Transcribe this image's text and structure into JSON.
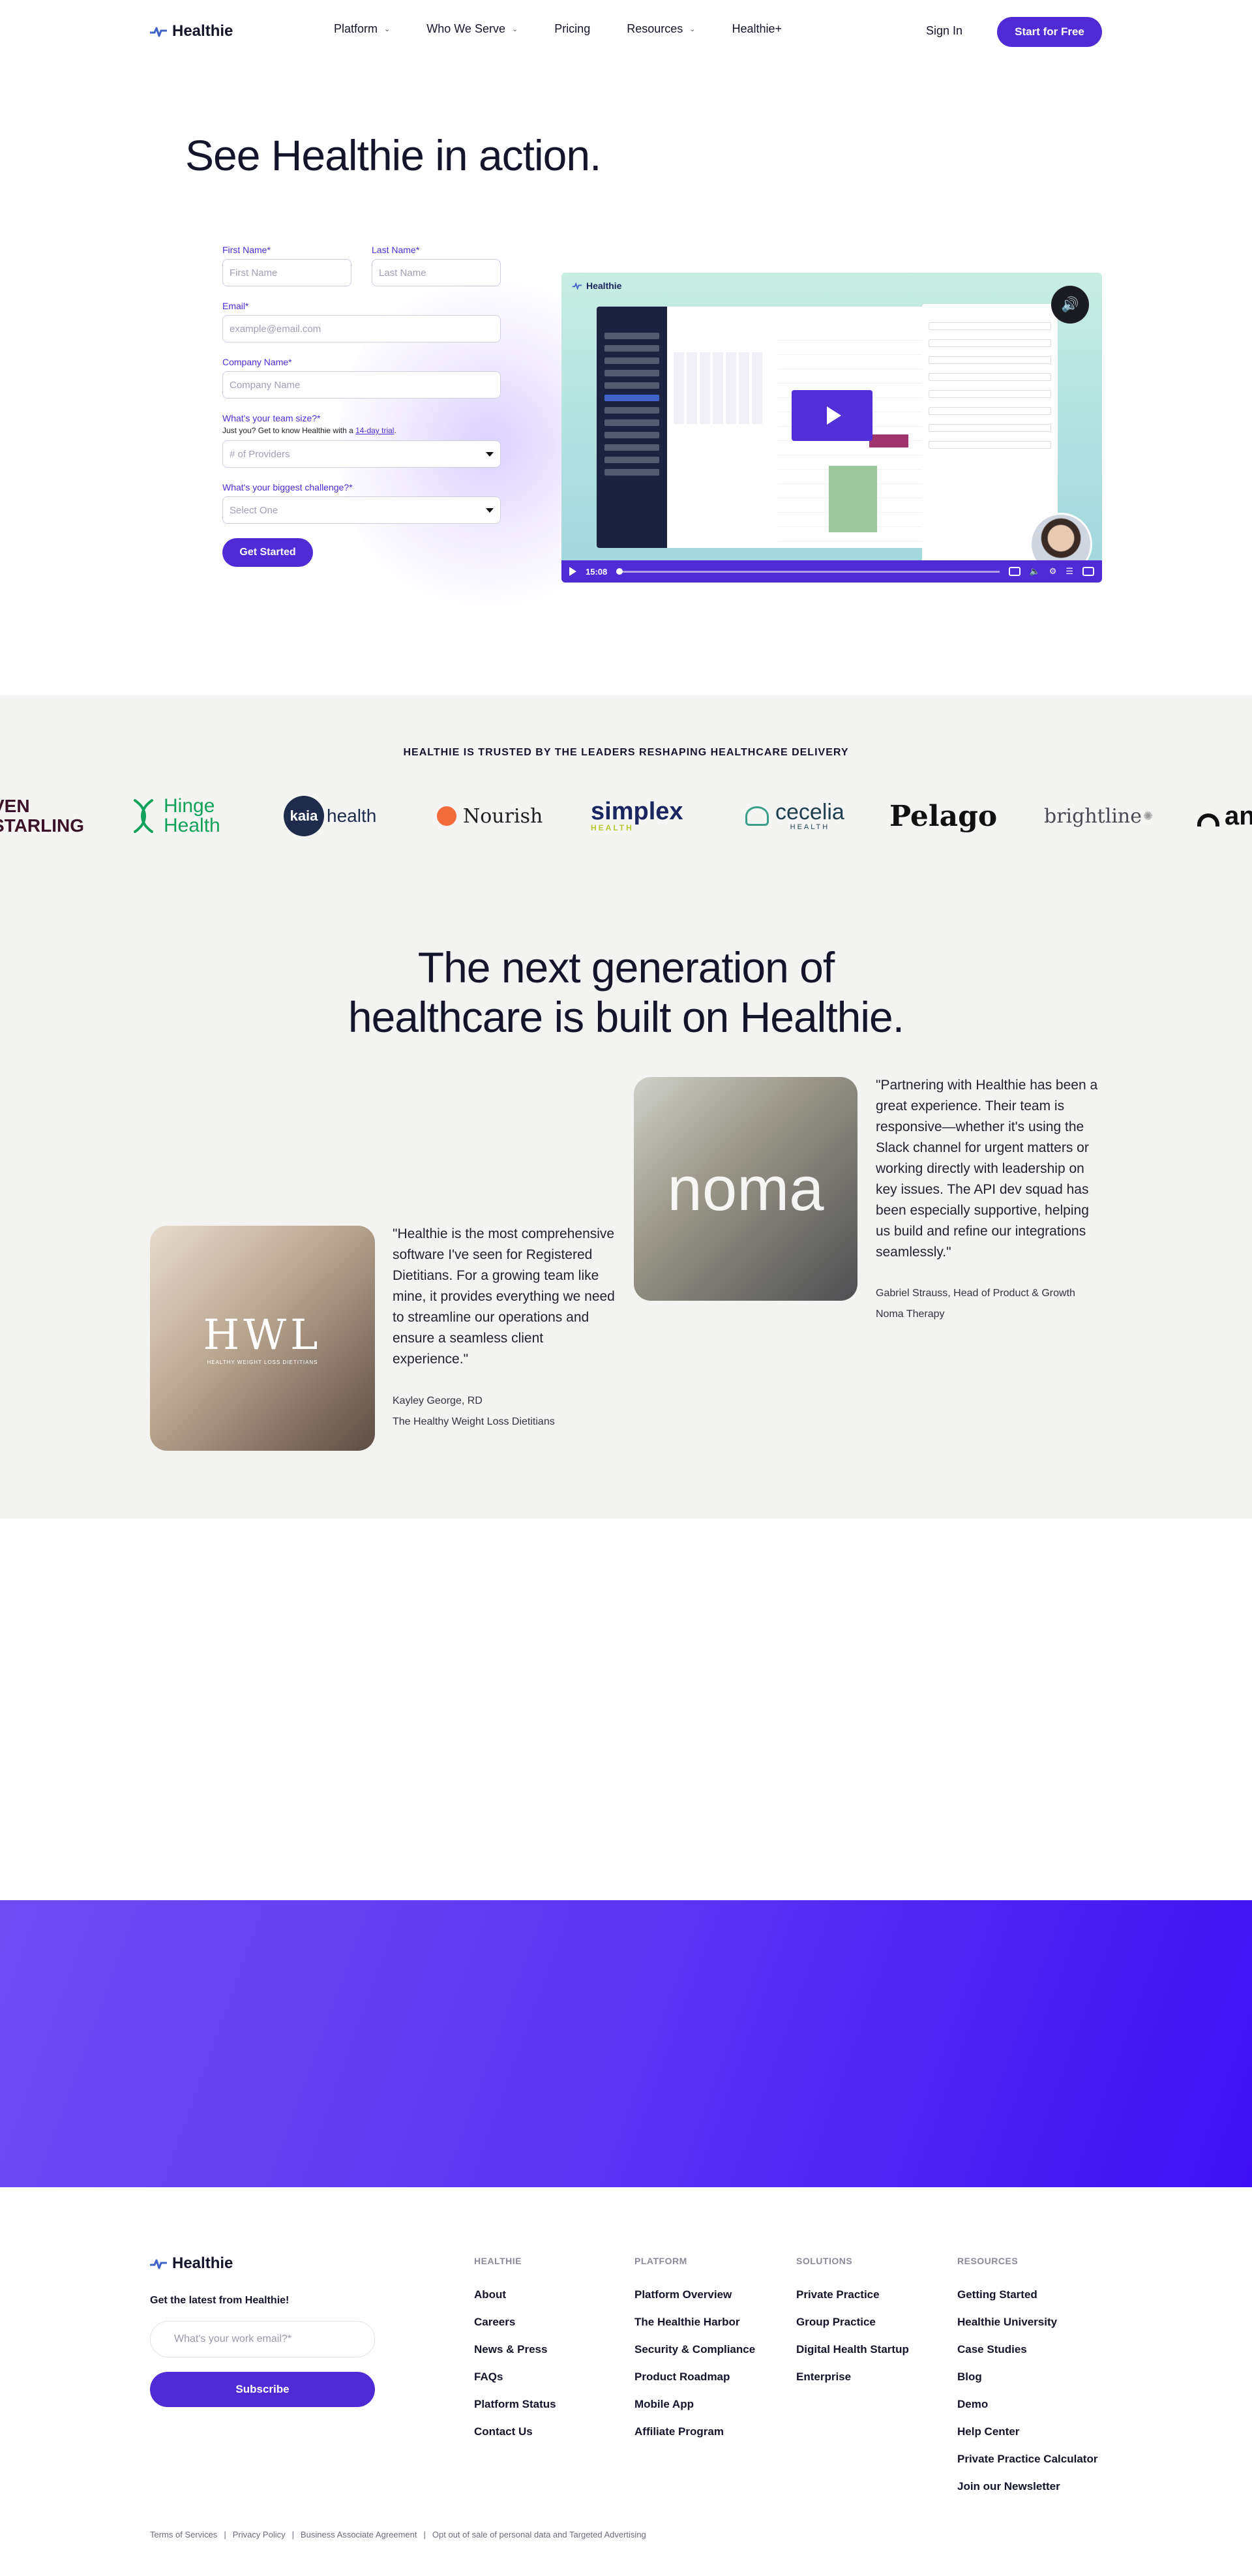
{
  "nav": {
    "brand": "Healthie",
    "links": [
      {
        "label": "Platform",
        "has_menu": true
      },
      {
        "label": "Who We Serve",
        "has_menu": true
      },
      {
        "label": "Pricing",
        "has_menu": false
      },
      {
        "label": "Resources",
        "has_menu": true
      },
      {
        "label": "Healthie+",
        "has_menu": false
      }
    ],
    "signin": "Sign In",
    "cta": "Start for Free"
  },
  "hero": {
    "title": "See Healthie in action."
  },
  "form": {
    "first_name_label": "First Name*",
    "first_name_placeholder": "First Name",
    "last_name_label": "Last Name*",
    "last_name_placeholder": "Last Name",
    "email_label": "Email*",
    "email_placeholder": "example@email.com",
    "company_label": "Company Name*",
    "company_placeholder": "Company Name",
    "team_size_label": "What's your team size?*",
    "team_size_hint": "Just you? Get to know Healthie with a ",
    "team_size_hint_link": "14-day trial",
    "team_size_hint_end": ".",
    "team_size_value": "# of Providers",
    "challenge_label": "What's your biggest challenge?*",
    "challenge_value": "Select One",
    "submit": "Get Started"
  },
  "video": {
    "brand": "Healthie",
    "time": "15:08",
    "sound_icon": "speaker-icon"
  },
  "trusted": {
    "title": "HEALTHIE IS TRUSTED BY THE LEADERS RESHAPING HEALTHCARE DELIVERY",
    "logos": [
      {
        "name": "seven-starling",
        "line1": "VEN",
        "line2": "STARLING",
        "color": "#3b1228"
      },
      {
        "name": "hinge-health",
        "line1": "Hinge",
        "line2": "Health",
        "color": "#11a35b"
      },
      {
        "name": "kaia-health",
        "badge": "kaia",
        "text": "health",
        "color": "#1f2b4a"
      },
      {
        "name": "nourish",
        "text": "Nourish",
        "color": "#1f1f1f",
        "accent": "#f26b3a"
      },
      {
        "name": "simplex-health",
        "text": "simplex",
        "sub": "HEALTH",
        "color": "#1b2560",
        "accent": "#b5c92a"
      },
      {
        "name": "cecelia-health",
        "text": "cecelia",
        "sub": "HEALTH",
        "color": "#1f3f4f",
        "accent": "#3aa08a"
      },
      {
        "name": "pelago",
        "text": "Pelago",
        "color": "#111111"
      },
      {
        "name": "brightline",
        "text": "brightline",
        "color": "#4a4a55"
      },
      {
        "name": "partial-logo",
        "text": "an",
        "color": "#111111"
      }
    ]
  },
  "testimonials": {
    "title_line1": "The next generation of",
    "title_line2": "healthcare is built on Healthie.",
    "items": [
      {
        "logo_text": "noma",
        "quote": "\"Partnering with Healthie has been a great experience. Their team is responsive—whether it's using the Slack channel for urgent matters or working directly with leadership on key issues. The API dev squad has been especially supportive, helping us build and refine our integrations seamlessly.\"",
        "author": "Gabriel Strauss, Head of Product & Growth",
        "org": "Noma Therapy"
      },
      {
        "logo_text": "HWL",
        "logo_sub": "HEALTHY WEIGHT LOSS DIETITIANS",
        "quote": "\"Healthie is the most comprehensive software I've seen for Registered Dietitians. For a growing team like mine, it provides everything we need to streamline our operations and ensure a seamless client experience.\"",
        "author": "Kayley George, RD",
        "org": "The Healthy Weight Loss Dietitians"
      }
    ]
  },
  "footer": {
    "brand": "Healthie",
    "newsletter_title": "Get the latest from Healthie!",
    "newsletter_placeholder": "What's your work email?*",
    "subscribe": "Subscribe",
    "columns": [
      {
        "heading": "HEALTHIE",
        "links": [
          "About",
          "Careers",
          "News & Press",
          "FAQs",
          "Platform Status",
          "Contact Us"
        ]
      },
      {
        "heading": "PLATFORM",
        "links": [
          "Platform Overview",
          "The Healthie Harbor",
          "Security & Compliance",
          "Product Roadmap",
          "Mobile App",
          "Affiliate Program"
        ]
      },
      {
        "heading": "SOLUTIONS",
        "links": [
          "Private Practice",
          "Group Practice",
          "Digital Health Startup",
          "Enterprise"
        ]
      },
      {
        "heading": "RESOURCES",
        "links": [
          "Getting Started",
          "Healthie University",
          "Case Studies",
          "Blog",
          "Demo",
          "Help Center",
          "Private Practice Calculator",
          "Join our Newsletter"
        ]
      }
    ],
    "legal": [
      "Terms of Services",
      "Privacy Policy",
      "Business Associate Agreement",
      "Opt out of sale of personal data and Targeted Advertising"
    ]
  },
  "colors": {
    "brand_purple": "#4f2bd6",
    "band_gray": "#f3f3f1"
  }
}
